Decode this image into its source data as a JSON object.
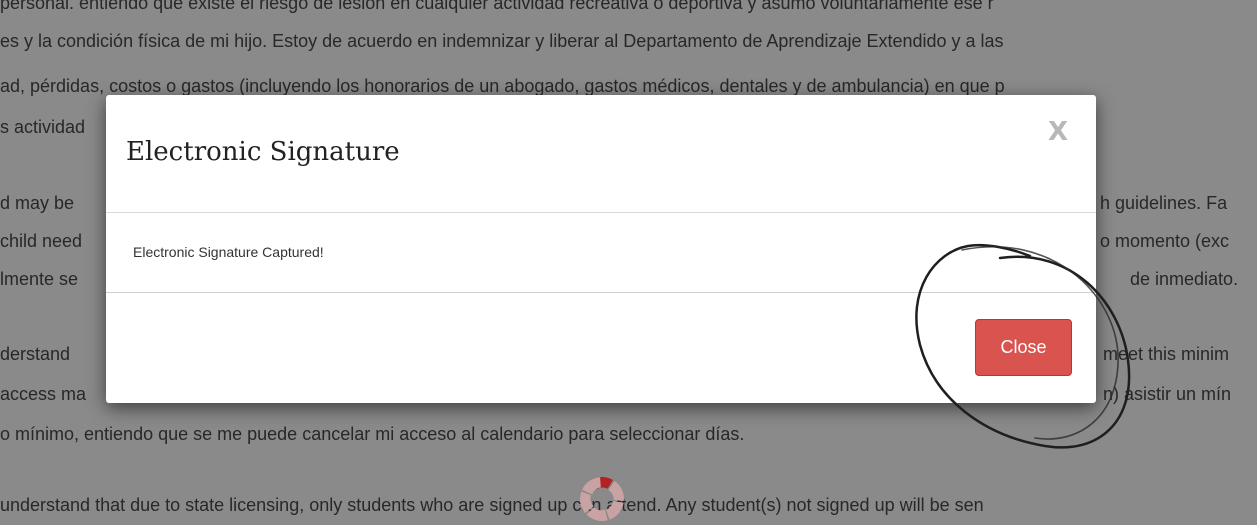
{
  "background": {
    "lines": [
      "personal. entiendo que existe el riesgo de lesión en cualquier actividad recreativa o deportiva y asumo voluntariamente ese r",
      "es y la condición física de mi hijo. Estoy de acuerdo en indemnizar y liberar al Departamento de Aprendizaje Extendido y a las",
      "ad, pérdidas, costos o gastos (incluyendo los honorarios de un abogado, gastos médicos, dentales y de ambulancia) en que p",
      "s actividad",
      "d may be",
      "child need",
      "lmente se",
      "derstand",
      "access ma",
      "o mínimo, entiendo que se me puede cancelar mi acceso al calendario para seleccionar días.",
      "understand that due to state licensing, only students who are signed up can attend. Any student(s) not signed up will be sen",
      "h guidelines. Fa",
      "o momento (exc",
      "de inmediato.",
      "meet this minim",
      "n) asistir un mín"
    ]
  },
  "modal": {
    "title": "Electronic Signature",
    "close_x": "X",
    "message": "Electronic Signature Captured!",
    "close_button_label": "Close"
  },
  "colors": {
    "overlay": "rgba(0,0,0,0.46)",
    "close_button": "#d9534f",
    "spinner_accent": "#b22222"
  }
}
